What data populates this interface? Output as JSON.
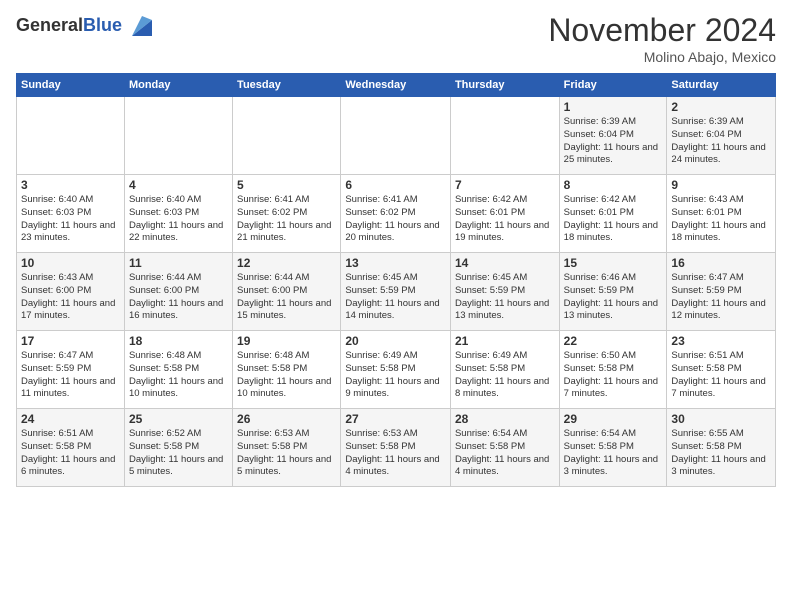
{
  "header": {
    "logo_general": "General",
    "logo_blue": "Blue",
    "month_title": "November 2024",
    "location": "Molino Abajo, Mexico"
  },
  "days_of_week": [
    "Sunday",
    "Monday",
    "Tuesday",
    "Wednesday",
    "Thursday",
    "Friday",
    "Saturday"
  ],
  "weeks": [
    [
      {
        "num": "",
        "info": ""
      },
      {
        "num": "",
        "info": ""
      },
      {
        "num": "",
        "info": ""
      },
      {
        "num": "",
        "info": ""
      },
      {
        "num": "",
        "info": ""
      },
      {
        "num": "1",
        "info": "Sunrise: 6:39 AM\nSunset: 6:04 PM\nDaylight: 11 hours and 25 minutes."
      },
      {
        "num": "2",
        "info": "Sunrise: 6:39 AM\nSunset: 6:04 PM\nDaylight: 11 hours and 24 minutes."
      }
    ],
    [
      {
        "num": "3",
        "info": "Sunrise: 6:40 AM\nSunset: 6:03 PM\nDaylight: 11 hours and 23 minutes."
      },
      {
        "num": "4",
        "info": "Sunrise: 6:40 AM\nSunset: 6:03 PM\nDaylight: 11 hours and 22 minutes."
      },
      {
        "num": "5",
        "info": "Sunrise: 6:41 AM\nSunset: 6:02 PM\nDaylight: 11 hours and 21 minutes."
      },
      {
        "num": "6",
        "info": "Sunrise: 6:41 AM\nSunset: 6:02 PM\nDaylight: 11 hours and 20 minutes."
      },
      {
        "num": "7",
        "info": "Sunrise: 6:42 AM\nSunset: 6:01 PM\nDaylight: 11 hours and 19 minutes."
      },
      {
        "num": "8",
        "info": "Sunrise: 6:42 AM\nSunset: 6:01 PM\nDaylight: 11 hours and 18 minutes."
      },
      {
        "num": "9",
        "info": "Sunrise: 6:43 AM\nSunset: 6:01 PM\nDaylight: 11 hours and 18 minutes."
      }
    ],
    [
      {
        "num": "10",
        "info": "Sunrise: 6:43 AM\nSunset: 6:00 PM\nDaylight: 11 hours and 17 minutes."
      },
      {
        "num": "11",
        "info": "Sunrise: 6:44 AM\nSunset: 6:00 PM\nDaylight: 11 hours and 16 minutes."
      },
      {
        "num": "12",
        "info": "Sunrise: 6:44 AM\nSunset: 6:00 PM\nDaylight: 11 hours and 15 minutes."
      },
      {
        "num": "13",
        "info": "Sunrise: 6:45 AM\nSunset: 5:59 PM\nDaylight: 11 hours and 14 minutes."
      },
      {
        "num": "14",
        "info": "Sunrise: 6:45 AM\nSunset: 5:59 PM\nDaylight: 11 hours and 13 minutes."
      },
      {
        "num": "15",
        "info": "Sunrise: 6:46 AM\nSunset: 5:59 PM\nDaylight: 11 hours and 13 minutes."
      },
      {
        "num": "16",
        "info": "Sunrise: 6:47 AM\nSunset: 5:59 PM\nDaylight: 11 hours and 12 minutes."
      }
    ],
    [
      {
        "num": "17",
        "info": "Sunrise: 6:47 AM\nSunset: 5:59 PM\nDaylight: 11 hours and 11 minutes."
      },
      {
        "num": "18",
        "info": "Sunrise: 6:48 AM\nSunset: 5:58 PM\nDaylight: 11 hours and 10 minutes."
      },
      {
        "num": "19",
        "info": "Sunrise: 6:48 AM\nSunset: 5:58 PM\nDaylight: 11 hours and 10 minutes."
      },
      {
        "num": "20",
        "info": "Sunrise: 6:49 AM\nSunset: 5:58 PM\nDaylight: 11 hours and 9 minutes."
      },
      {
        "num": "21",
        "info": "Sunrise: 6:49 AM\nSunset: 5:58 PM\nDaylight: 11 hours and 8 minutes."
      },
      {
        "num": "22",
        "info": "Sunrise: 6:50 AM\nSunset: 5:58 PM\nDaylight: 11 hours and 7 minutes."
      },
      {
        "num": "23",
        "info": "Sunrise: 6:51 AM\nSunset: 5:58 PM\nDaylight: 11 hours and 7 minutes."
      }
    ],
    [
      {
        "num": "24",
        "info": "Sunrise: 6:51 AM\nSunset: 5:58 PM\nDaylight: 11 hours and 6 minutes."
      },
      {
        "num": "25",
        "info": "Sunrise: 6:52 AM\nSunset: 5:58 PM\nDaylight: 11 hours and 5 minutes."
      },
      {
        "num": "26",
        "info": "Sunrise: 6:53 AM\nSunset: 5:58 PM\nDaylight: 11 hours and 5 minutes."
      },
      {
        "num": "27",
        "info": "Sunrise: 6:53 AM\nSunset: 5:58 PM\nDaylight: 11 hours and 4 minutes."
      },
      {
        "num": "28",
        "info": "Sunrise: 6:54 AM\nSunset: 5:58 PM\nDaylight: 11 hours and 4 minutes."
      },
      {
        "num": "29",
        "info": "Sunrise: 6:54 AM\nSunset: 5:58 PM\nDaylight: 11 hours and 3 minutes."
      },
      {
        "num": "30",
        "info": "Sunrise: 6:55 AM\nSunset: 5:58 PM\nDaylight: 11 hours and 3 minutes."
      }
    ]
  ]
}
